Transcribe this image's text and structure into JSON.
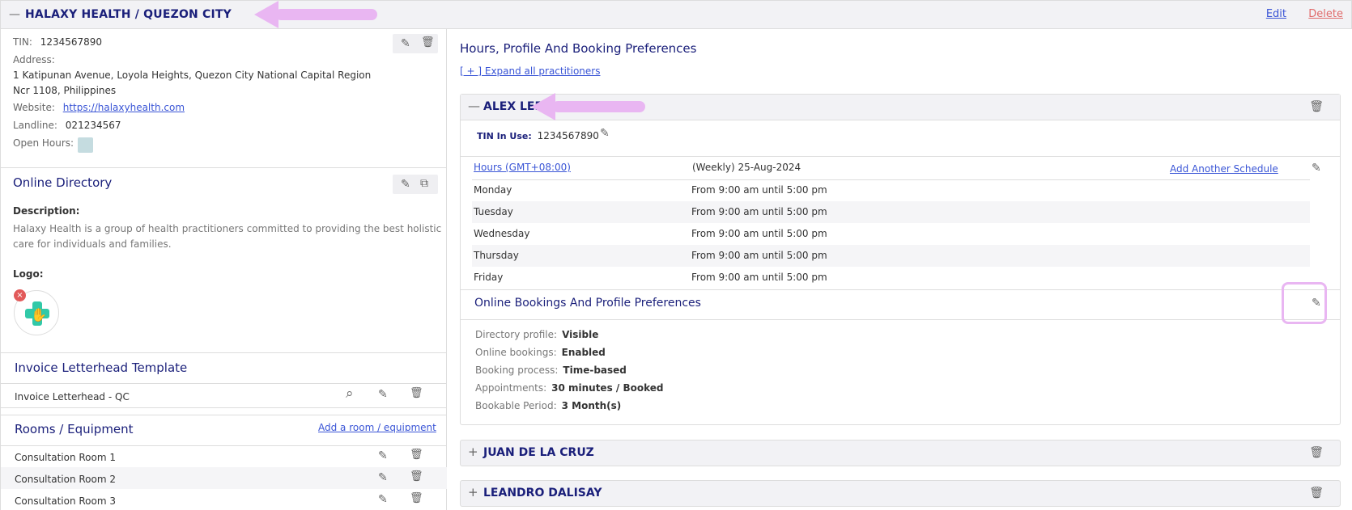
{
  "header": {
    "collapse_symbol": "—",
    "title": "HALAXY HEALTH / QUEZON CITY",
    "edit_label": "Edit",
    "delete_label": "Delete"
  },
  "clinic": {
    "tin_label": "TIN:",
    "tin_value": "1234567890",
    "address_label": "Address:",
    "address_line1": "1 Katipunan Avenue, Loyola Heights, Quezon City National Capital Region",
    "address_line2": "Ncr 1108, Philippines",
    "website_label": "Website:",
    "website_value": "https://halaxyhealth.com",
    "landline_label": "Landline:",
    "landline_value": "021234567",
    "open_hours_label": "Open Hours:"
  },
  "directory": {
    "title": "Online Directory",
    "description_label": "Description:",
    "description_line1": "Halaxy Health is a group of health practitioners committed to providing the best holistic",
    "description_line2": "care for individuals and families.",
    "logo_label": "Logo:",
    "remove_symbol": "×"
  },
  "letterhead": {
    "title": "Invoice Letterhead Template",
    "item": "Invoice Letterhead - QC"
  },
  "rooms": {
    "title": "Rooms / Equipment",
    "add_label": "Add a room / equipment",
    "items": [
      "Consultation Room 1",
      "Consultation Room 2",
      "Consultation Room 3"
    ]
  },
  "hours_section": {
    "title": "Hours, Profile And Booking Preferences",
    "expand_all": "[ + ] Expand all practitioners"
  },
  "practitioner": {
    "collapse_symbol": "—",
    "name": "ALEX LEE",
    "tin_label": "TIN In Use:",
    "tin_value": "1234567890",
    "hours_link": "Hours (GMT+08:00)",
    "schedule_label": "(Weekly) 25-Aug-2024",
    "add_schedule": "Add Another Schedule",
    "days": [
      {
        "day": "Monday",
        "time": "From 9:00 am until 5:00 pm"
      },
      {
        "day": "Tuesday",
        "time": "From 9:00 am until 5:00 pm"
      },
      {
        "day": "Wednesday",
        "time": "From 9:00 am until 5:00 pm"
      },
      {
        "day": "Thursday",
        "time": "From 9:00 am until 5:00 pm"
      },
      {
        "day": "Friday",
        "time": "From 9:00 am until 5:00 pm"
      }
    ],
    "prefs_title": "Online Bookings And Profile Preferences",
    "prefs": [
      {
        "label": "Directory profile:",
        "value": "Visible"
      },
      {
        "label": "Online bookings:",
        "value": "Enabled"
      },
      {
        "label": "Booking process:",
        "value": "Time-based"
      },
      {
        "label": "Appointments:",
        "value": "30 minutes / Booked"
      },
      {
        "label": "Bookable Period:",
        "value": "3 Month(s)"
      }
    ]
  },
  "other_practitioners": [
    {
      "expand_symbol": "+",
      "name": "JUAN DE LA CRUZ"
    },
    {
      "expand_symbol": "+",
      "name": "LEANDRO DALISAY"
    }
  ],
  "icons": {
    "edit": "✎",
    "delete": "🗑",
    "external": "⧉",
    "search": "⌕"
  },
  "colors": {
    "accent": "#1a1f7a",
    "link": "#3a55d6",
    "danger": "#e06a6a",
    "annotation": "#e9b6f2"
  }
}
